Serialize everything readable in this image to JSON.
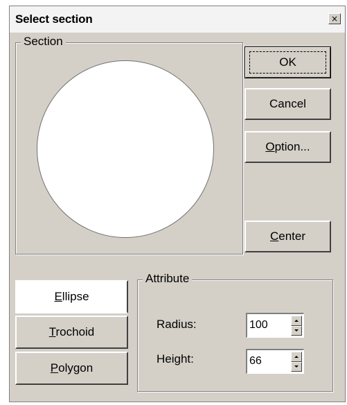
{
  "dialog": {
    "title": "Select section",
    "close_glyph": "×"
  },
  "section": {
    "legend": "Section",
    "preview_shape": "circle"
  },
  "buttons": {
    "ok": {
      "mnemonic": "",
      "rest": "OK"
    },
    "cancel": {
      "mnemonic": "",
      "rest": "Cancel"
    },
    "option": {
      "mnemonic": "O",
      "rest": "ption..."
    },
    "center": {
      "mnemonic": "C",
      "rest": "enter"
    }
  },
  "shapes": [
    {
      "mnemonic": "E",
      "rest": "llipse",
      "selected": true
    },
    {
      "mnemonic": "T",
      "rest": "rochoid",
      "selected": false
    },
    {
      "mnemonic": "P",
      "rest": "olygon",
      "selected": false
    }
  ],
  "attribute": {
    "legend": "Attribute",
    "radius": {
      "label": "Radius:",
      "value": "100"
    },
    "height": {
      "label": "Height:",
      "value": "66"
    }
  },
  "colors": {
    "face": "#d4d0c8",
    "title_bar": "#f3f3f3",
    "preview_fill": "#ffffff"
  }
}
